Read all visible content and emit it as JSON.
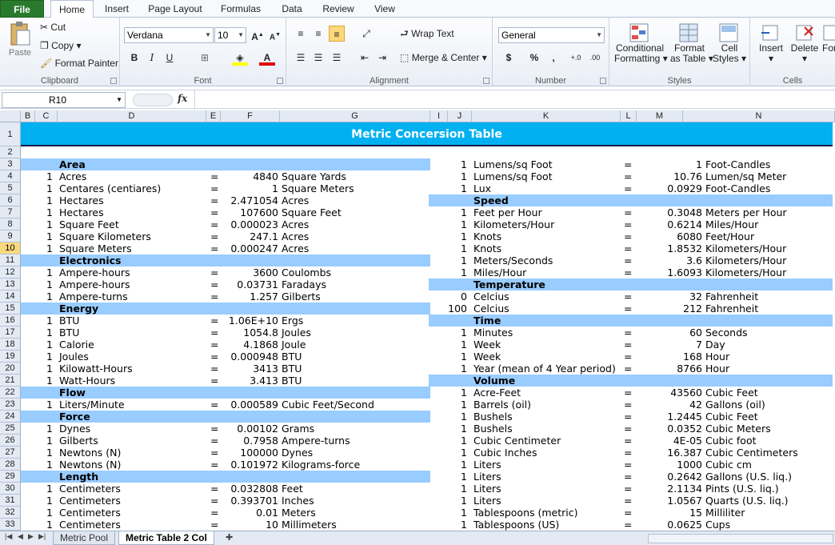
{
  "tabs": [
    "File",
    "Home",
    "Insert",
    "Page Layout",
    "Formulas",
    "Data",
    "Review",
    "View"
  ],
  "clipboard": {
    "paste": "Paste",
    "cut": "Cut",
    "copy": "Copy",
    "painter": "Format Painter",
    "label": "Clipboard"
  },
  "font": {
    "name": "Verdana",
    "size": "10",
    "label": "Font"
  },
  "alignment": {
    "wrap": "Wrap Text",
    "merge": "Merge & Center",
    "label": "Alignment"
  },
  "number": {
    "format": "General",
    "currency": "$",
    "percent": "%",
    "comma": ",",
    "inc": "+.0",
    "dec": ".00",
    "label": "Number"
  },
  "styles": {
    "cond1": "Conditional",
    "cond2": "Formatting",
    "fmt1": "Format",
    "fmt2": "as Table",
    "cell1": "Cell",
    "cell2": "Styles",
    "label": "Styles"
  },
  "cells": {
    "insert": "Insert",
    "delete": "Delete",
    "format": "For",
    "label": "Cells"
  },
  "formula": {
    "namebox": "R10",
    "fx": "fx"
  },
  "columns": [
    "B",
    "C",
    "D",
    "E",
    "F",
    "G",
    "I",
    "J",
    "K",
    "L",
    "M",
    "N"
  ],
  "title": "Metric Concersion Table",
  "left": [
    {
      "cat": "Area"
    },
    {
      "n": "1",
      "u": "Acres",
      "eq": "=",
      "v": "4840",
      "t": "Square Yards"
    },
    {
      "n": "1",
      "u": "Centares (centiares)",
      "eq": "=",
      "v": "1",
      "t": "Square Meters"
    },
    {
      "n": "1",
      "u": "Hectares",
      "eq": "=",
      "v": "2.471054",
      "t": "Acres"
    },
    {
      "n": "1",
      "u": "Hectares",
      "eq": "=",
      "v": "107600",
      "t": "Square Feet"
    },
    {
      "n": "1",
      "u": "Square Feet",
      "eq": "=",
      "v": "0.000023",
      "t": "Acres"
    },
    {
      "n": "1",
      "u": "Square Kilometers",
      "eq": "=",
      "v": "247.1",
      "t": "Acres"
    },
    {
      "n": "1",
      "u": "Square Meters",
      "eq": "=",
      "v": "0.000247",
      "t": "Acres"
    },
    {
      "cat": "Electronics"
    },
    {
      "n": "1",
      "u": "Ampere-hours",
      "eq": "=",
      "v": "3600",
      "t": "Coulombs"
    },
    {
      "n": "1",
      "u": "Ampere-hours",
      "eq": "=",
      "v": "0.03731",
      "t": "Faradays"
    },
    {
      "n": "1",
      "u": "Ampere-turns",
      "eq": "=",
      "v": "1.257",
      "t": "Gilberts"
    },
    {
      "cat": "Energy"
    },
    {
      "n": "1",
      "u": "BTU",
      "eq": "=",
      "v": "1.06E+10",
      "t": "Ergs"
    },
    {
      "n": "1",
      "u": "BTU",
      "eq": "=",
      "v": "1054.8",
      "t": "Joules"
    },
    {
      "n": "1",
      "u": "Calorie",
      "eq": "=",
      "v": "4.1868",
      "t": "Joule"
    },
    {
      "n": "1",
      "u": "Joules",
      "eq": "=",
      "v": "0.000948",
      "t": "BTU"
    },
    {
      "n": "1",
      "u": "Kilowatt-Hours",
      "eq": "=",
      "v": "3413",
      "t": "BTU"
    },
    {
      "n": "1",
      "u": "Watt-Hours",
      "eq": "=",
      "v": "3.413",
      "t": "BTU"
    },
    {
      "cat": "Flow"
    },
    {
      "n": "1",
      "u": "Liters/Minute",
      "eq": "=",
      "v": "0.000589",
      "t": "Cubic Feet/Second"
    },
    {
      "cat": "Force"
    },
    {
      "n": "1",
      "u": "Dynes",
      "eq": "=",
      "v": "0.00102",
      "t": "Grams"
    },
    {
      "n": "1",
      "u": "Gilberts",
      "eq": "=",
      "v": "0.7958",
      "t": "Ampere-turns"
    },
    {
      "n": "1",
      "u": "Newtons (N)",
      "eq": "=",
      "v": "100000",
      "t": "Dynes"
    },
    {
      "n": "1",
      "u": "Newtons (N)",
      "eq": "=",
      "v": "0.101972",
      "t": "Kilograms-force"
    },
    {
      "cat": "Length"
    },
    {
      "n": "1",
      "u": "Centimeters",
      "eq": "=",
      "v": "0.032808",
      "t": "Feet"
    },
    {
      "n": "1",
      "u": "Centimeters",
      "eq": "=",
      "v": "0.393701",
      "t": "Inches"
    },
    {
      "n": "1",
      "u": "Centimeters",
      "eq": "=",
      "v": "0.01",
      "t": "Meters"
    },
    {
      "n": "1",
      "u": "Centimeters",
      "eq": "=",
      "v": "10",
      "t": "Millimeters"
    }
  ],
  "right": [
    {
      "n": "1",
      "u": "Lumens/sq Foot",
      "eq": "=",
      "v": "1",
      "t": "Foot-Candles"
    },
    {
      "n": "1",
      "u": "Lumens/sq Foot",
      "eq": "=",
      "v": "10.76",
      "t": "Lumen/sq Meter"
    },
    {
      "n": "1",
      "u": "Lux",
      "eq": "=",
      "v": "0.0929",
      "t": "Foot-Candles"
    },
    {
      "cat": "Speed"
    },
    {
      "n": "1",
      "u": "Feet per Hour",
      "eq": "=",
      "v": "0.3048",
      "t": "Meters per Hour"
    },
    {
      "n": "1",
      "u": "Kilometers/Hour",
      "eq": "=",
      "v": "0.6214",
      "t": "Miles/Hour"
    },
    {
      "n": "1",
      "u": "Knots",
      "eq": "=",
      "v": "6080",
      "t": "Feet/Hour"
    },
    {
      "n": "1",
      "u": "Knots",
      "eq": "=",
      "v": "1.8532",
      "t": "Kilometers/Hour"
    },
    {
      "n": "1",
      "u": "Meters/Seconds",
      "eq": "=",
      "v": "3.6",
      "t": "Kilometers/Hour"
    },
    {
      "n": "1",
      "u": "Miles/Hour",
      "eq": "=",
      "v": "1.6093",
      "t": "Kilometers/Hour"
    },
    {
      "cat": "Temperature"
    },
    {
      "n": "0",
      "u": "Celcius",
      "eq": "=",
      "v": "32",
      "t": "Fahrenheit"
    },
    {
      "n": "100",
      "u": "Celcius",
      "eq": "=",
      "v": "212",
      "t": "Fahrenheit"
    },
    {
      "cat": "Time"
    },
    {
      "n": "1",
      "u": "Minutes",
      "eq": "=",
      "v": "60",
      "t": "Seconds"
    },
    {
      "n": "1",
      "u": "Week",
      "eq": "=",
      "v": "7",
      "t": "Day"
    },
    {
      "n": "1",
      "u": "Week",
      "eq": "=",
      "v": "168",
      "t": "Hour"
    },
    {
      "n": "1",
      "u": "Year (mean of 4 Year period)",
      "eq": "=",
      "v": "8766",
      "t": "Hour"
    },
    {
      "cat": "Volume"
    },
    {
      "n": "1",
      "u": "Acre-Feet",
      "eq": "=",
      "v": "43560",
      "t": "Cubic Feet"
    },
    {
      "n": "1",
      "u": "Barrels (oil)",
      "eq": "=",
      "v": "42",
      "t": "Gallons (oil)"
    },
    {
      "n": "1",
      "u": "Bushels",
      "eq": "=",
      "v": "1.2445",
      "t": "Cubic Feet"
    },
    {
      "n": "1",
      "u": "Bushels",
      "eq": "=",
      "v": "0.0352",
      "t": "Cubic Meters"
    },
    {
      "n": "1",
      "u": "Cubic Centimeter",
      "eq": "=",
      "v": "4E-05",
      "t": "Cubic foot"
    },
    {
      "n": "1",
      "u": "Cubic Inches",
      "eq": "=",
      "v": "16.387",
      "t": "Cubic Centimeters"
    },
    {
      "n": "1",
      "u": "Liters",
      "eq": "=",
      "v": "1000",
      "t": "Cubic cm"
    },
    {
      "n": "1",
      "u": "Liters",
      "eq": "=",
      "v": "0.2642",
      "t": "Gallons (U.S. liq.)"
    },
    {
      "n": "1",
      "u": "Liters",
      "eq": "=",
      "v": "2.1134",
      "t": "Pints (U.S. liq.)"
    },
    {
      "n": "1",
      "u": "Liters",
      "eq": "=",
      "v": "1.0567",
      "t": "Quarts (U.S. liq.)"
    },
    {
      "n": "1",
      "u": "Tablespoons (metric)",
      "eq": "=",
      "v": "15",
      "t": "Milliliter"
    },
    {
      "n": "1",
      "u": "Tablespoons (US)",
      "eq": "=",
      "v": "0.0625",
      "t": "Cups"
    }
  ],
  "rows": [
    "1",
    "2",
    "3",
    "4",
    "5",
    "6",
    "7",
    "8",
    "9",
    "10",
    "11",
    "12",
    "13",
    "14",
    "15",
    "16",
    "17",
    "18",
    "19",
    "20",
    "21",
    "22",
    "23",
    "24",
    "25",
    "26",
    "27",
    "28",
    "29",
    "30",
    "31",
    "32",
    "33"
  ],
  "sheets": [
    "Metric Pool",
    "Metric Table 2 Col"
  ],
  "accent": "#00b0f0",
  "cat_color": "#99ccff"
}
